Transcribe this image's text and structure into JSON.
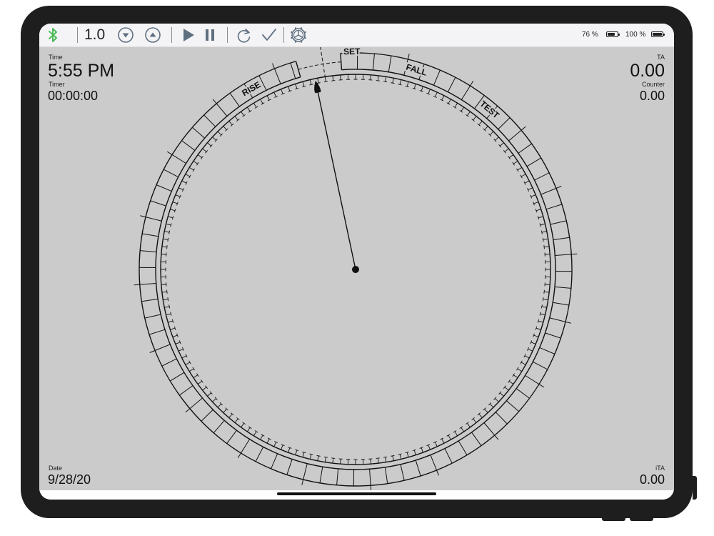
{
  "toolbar": {
    "bluetooth_icon": "bluetooth-icon",
    "rate_value": "1.0",
    "decrease_icon": "chevron-down-circle-icon",
    "increase_icon": "chevron-up-circle-icon",
    "play_icon": "play-icon",
    "pause_icon": "pause-icon",
    "reset_icon": "redo-icon",
    "confirm_icon": "checkmark-icon",
    "settings_icon": "gear-icon",
    "accent_color": "#5e6f80",
    "bluetooth_color": "#4cbb5a"
  },
  "status": {
    "device_battery_text": "76 %",
    "device_battery_level": 0.76,
    "remote_battery_text": "100 %",
    "remote_battery_level": 1.0
  },
  "readouts": {
    "time_label": "Time",
    "time_value": "5:55 PM",
    "timer_label": "Timer",
    "timer_value": "00:00:00",
    "ta_label": "TA",
    "ta_value": "0.00",
    "counter_label": "Counter",
    "counter_value": "0.00",
    "date_label": "Date",
    "date_value": "9/28/20",
    "ita_label": "iTA",
    "ita_value": "0.00"
  },
  "dial": {
    "labels": {
      "set": "SET",
      "rise": "RISE",
      "fall": "FALL",
      "test": "TEST"
    },
    "needle_angle_deg": -12,
    "background_color": "#cbcbcb",
    "ink_color": "#111111"
  }
}
